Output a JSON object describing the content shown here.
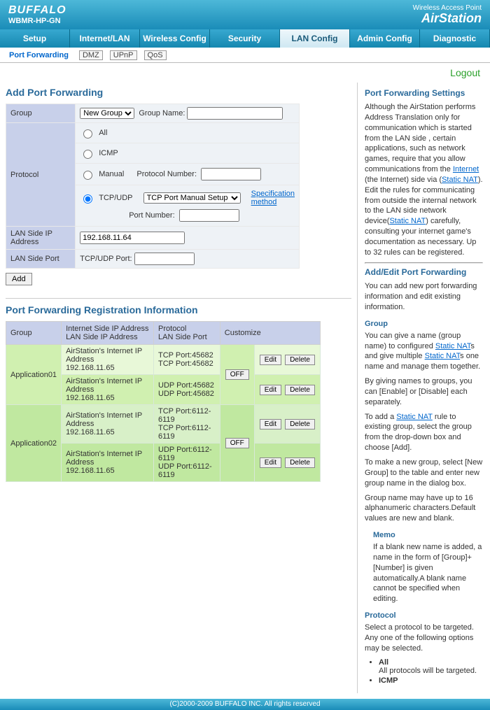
{
  "header": {
    "brand": "BUFFALO",
    "model": "WBMR-HP-GN",
    "tagline": "Wireless Access Point",
    "product": "AirStation"
  },
  "nav": {
    "items": [
      "Setup",
      "Internet/LAN",
      "Wireless Config",
      "Security",
      "LAN Config",
      "Admin Config",
      "Diagnostic"
    ],
    "active": "LAN Config"
  },
  "subnav": {
    "items": [
      "Port Forwarding",
      "DMZ",
      "UPnP",
      "QoS"
    ],
    "active": "Port Forwarding"
  },
  "logout": "Logout",
  "addForm": {
    "title": "Add Port Forwarding",
    "groupLabel": "Group",
    "groupSelect": "New Group",
    "groupNameLabel": "Group Name:",
    "groupNameValue": "",
    "protocolLabel": "Protocol",
    "radioAll": "All",
    "radioICMP": "ICMP",
    "radioManual": "Manual",
    "protocolNumberLabel": "Protocol Number:",
    "protocolNumberValue": "",
    "radioTCPUDP": "TCP/UDP",
    "tcpSetupSelect": "TCP Port Manual Setup",
    "specMethod": "Specification method",
    "portNumberLabel": "Port Number:",
    "portNumberValue": "",
    "lanIpLabel": "LAN Side IP Address",
    "lanIpValue": "192.168.11.64",
    "lanPortLabel": "LAN Side Port",
    "tcpudpPortLabel": "TCP/UDP Port:",
    "tcpudpPortValue": "",
    "addBtn": "Add"
  },
  "regTable": {
    "title": "Port Forwarding Registration Information",
    "headers": {
      "group": "Group",
      "addr1": "Internet Side IP Address",
      "addr2": "LAN Side IP Address",
      "proto1": "Protocol",
      "proto2": "LAN Side Port",
      "customize": "Customize"
    },
    "rows": [
      {
        "group": "Application01",
        "addr": "AirStation's Internet IP Address",
        "lan": "192.168.11.65",
        "proto": "TCP Port:45682",
        "lport": "TCP Port:45682",
        "toggle": "OFF"
      },
      {
        "group": "",
        "addr": "AirStation's Internet IP Address",
        "lan": "192.168.11.65",
        "proto": "UDP Port:45682",
        "lport": "UDP Port:45682",
        "toggle": ""
      },
      {
        "group": "Application02",
        "addr": "AirStation's Internet IP Address",
        "lan": "192.168.11.65",
        "proto": "TCP Port:6112-6119",
        "lport": "TCP Port:6112-6119",
        "toggle": "OFF"
      },
      {
        "group": "",
        "addr": "AirStation's Internet IP Address",
        "lan": "192.168.11.65",
        "proto": "UDP Port:6112-6119",
        "lport": "UDP Port:6112-6119",
        "toggle": ""
      }
    ],
    "editBtn": "Edit",
    "deleteBtn": "Delete"
  },
  "help": {
    "title": "Port Forwarding Settings",
    "intro1": "Although the AirStation performs Address Translation only for communication which is started from the LAN side , certain applications, such as network games, require that you allow communications from the ",
    "introLink1": "Internet",
    "intro2": " (the Internet) side via (",
    "introLink2": "Static NAT",
    "intro3": "). Edit the rules for communicating from outside the internal network to the LAN side network device(",
    "introLink3": "Static NAT",
    "intro4": ") carefully, consulting your internet game's documentation as necessary. Up to 32 rules can be registered.",
    "addEditTitle": "Add/Edit Port Forwarding",
    "addEditText": "You can add new port forwarding information and edit existing information.",
    "groupTitle": "Group",
    "groupP1a": "You can give a name (group name) to configured ",
    "groupLinkA": "Static NAT",
    "groupP1b": "s and give multiple ",
    "groupLinkB": "Static NAT",
    "groupP1c": "s one name and manage them together.",
    "groupP2": "By giving names to groups, you can [Enable] or [Disable] each separately.",
    "groupP3a": "To add a ",
    "groupLinkC": "Static NAT",
    "groupP3b": " rule to existing group, select the group from the drop-down box and choose [Add].",
    "groupP4": "To make a new group, select [New Group] to the table and enter new group name in the dialog box.",
    "groupP5": "Group name may have up to 16 alphanumeric characters.Default values are new and blank.",
    "memoTitle": "Memo",
    "memoText": "If a blank new name is added, a name in the form of [Group]+[Number] is given automatically.A blank name cannot be specified when editing.",
    "protoTitle": "Protocol",
    "protoText": "Select a protocol to be targeted. Any one of the following options may be selected.",
    "protoAll": "All",
    "protoAllDesc": "All protocols will be targeted.",
    "protoICMP": "ICMP"
  },
  "footer": "(C)2000-2009 BUFFALO INC. All rights reserved"
}
